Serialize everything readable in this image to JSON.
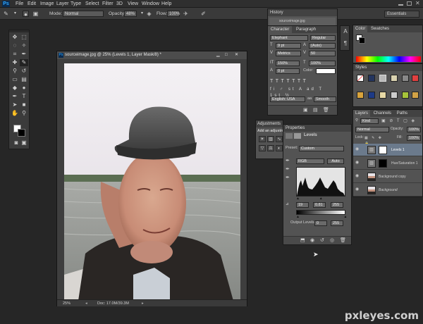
{
  "menu": {
    "app_logo": "Ps",
    "items": [
      "File",
      "Edit",
      "Image",
      "Layer",
      "Type",
      "Select",
      "Filter",
      "3D",
      "View",
      "Window",
      "Help"
    ]
  },
  "options_bar": {
    "mode_label": "Mode:",
    "mode_value": "Normal",
    "opacity_label": "Opacity:",
    "opacity_value": "48%",
    "flow_label": "Flow:",
    "flow_value": "100%",
    "workspace": "Essentials"
  },
  "document": {
    "title": "sourceimage.jpg @ 25% (Levels 1, Layer Mask/8) *",
    "zoom": "25%",
    "doc_size": "Doc: 17.0M/39.3M"
  },
  "history_panel": {
    "tab": "History",
    "item": "sourceimage.jpg"
  },
  "character_panel": {
    "tabs": [
      "Character",
      "Paragraph"
    ],
    "font_family": "Elephant",
    "font_style": "Regular",
    "size": "9 pt",
    "leading": "(Auto)",
    "kerning": "Metrics",
    "tracking": "50",
    "vscale": "150%",
    "hscale": "100%",
    "baseline": "0 pt",
    "color_label": "Color:",
    "language": "English: USA",
    "aa_icon": "aa",
    "antialias": "Smooth"
  },
  "adjustments_panel": {
    "tab": "Adjustments",
    "title": "Add an adjustment"
  },
  "properties_panel": {
    "tab": "Properties",
    "type": "Levels",
    "preset_label": "Preset:",
    "preset_value": "Custom",
    "channel": "RGB",
    "auto": "Auto",
    "input_shadow": "19",
    "input_mid": "0.81",
    "input_high": "255",
    "output_label": "Output Levels:",
    "output_low": "0",
    "output_high": "255"
  },
  "color_panel": {
    "tabs": [
      "Color",
      "Swatches"
    ]
  },
  "styles_panel": {
    "tab": "Styles"
  },
  "layers_panel": {
    "tabs": [
      "Layers",
      "Channels",
      "Paths"
    ],
    "kind": "Kind",
    "blend": "Normal",
    "opacity_label": "Opacity:",
    "opacity": "100%",
    "lock_label": "Lock:",
    "fill_label": "Fill:",
    "fill": "100%",
    "layers": [
      "Levels 1",
      "Hue/Saturation 1",
      "Background copy",
      "Background"
    ]
  },
  "watermark": "pxleyes.com"
}
